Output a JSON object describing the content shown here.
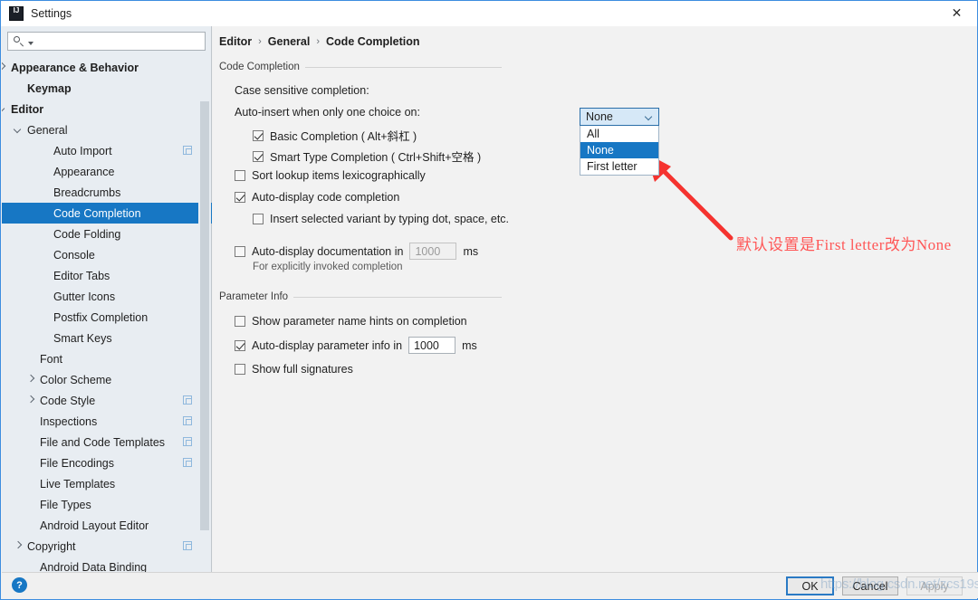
{
  "window": {
    "title": "Settings",
    "logo_icon": "intellij-logo-icon",
    "close_icon": "close-icon"
  },
  "search": {
    "value": "",
    "placeholder": "",
    "icon": "search-icon",
    "caret_icon": "chevron-down-icon"
  },
  "sidebar": {
    "items": [
      {
        "label": "Appearance & Behavior",
        "indent": 10,
        "arrow": "right",
        "bold": true,
        "selected": false,
        "badge": false
      },
      {
        "label": "Keymap",
        "indent": 28,
        "arrow": "none",
        "bold": true,
        "selected": false,
        "badge": false
      },
      {
        "label": "Editor",
        "indent": 10,
        "arrow": "down",
        "bold": true,
        "selected": false,
        "badge": false
      },
      {
        "label": "General",
        "indent": 28,
        "arrow": "down",
        "bold": false,
        "selected": false,
        "badge": false
      },
      {
        "label": "Auto Import",
        "indent": 57,
        "arrow": "none",
        "bold": false,
        "selected": false,
        "badge": true
      },
      {
        "label": "Appearance",
        "indent": 57,
        "arrow": "none",
        "bold": false,
        "selected": false,
        "badge": false
      },
      {
        "label": "Breadcrumbs",
        "indent": 57,
        "arrow": "none",
        "bold": false,
        "selected": false,
        "badge": false
      },
      {
        "label": "Code Completion",
        "indent": 57,
        "arrow": "none",
        "bold": false,
        "selected": true,
        "badge": false
      },
      {
        "label": "Code Folding",
        "indent": 57,
        "arrow": "none",
        "bold": false,
        "selected": false,
        "badge": false
      },
      {
        "label": "Console",
        "indent": 57,
        "arrow": "none",
        "bold": false,
        "selected": false,
        "badge": false
      },
      {
        "label": "Editor Tabs",
        "indent": 57,
        "arrow": "none",
        "bold": false,
        "selected": false,
        "badge": false
      },
      {
        "label": "Gutter Icons",
        "indent": 57,
        "arrow": "none",
        "bold": false,
        "selected": false,
        "badge": false
      },
      {
        "label": "Postfix Completion",
        "indent": 57,
        "arrow": "none",
        "bold": false,
        "selected": false,
        "badge": false
      },
      {
        "label": "Smart Keys",
        "indent": 57,
        "arrow": "none",
        "bold": false,
        "selected": false,
        "badge": false
      },
      {
        "label": "Font",
        "indent": 42,
        "arrow": "none",
        "bold": false,
        "selected": false,
        "badge": false
      },
      {
        "label": "Color Scheme",
        "indent": 42,
        "arrow": "right",
        "bold": false,
        "selected": false,
        "badge": false
      },
      {
        "label": "Code Style",
        "indent": 42,
        "arrow": "right",
        "bold": false,
        "selected": false,
        "badge": true
      },
      {
        "label": "Inspections",
        "indent": 42,
        "arrow": "none",
        "bold": false,
        "selected": false,
        "badge": true
      },
      {
        "label": "File and Code Templates",
        "indent": 42,
        "arrow": "none",
        "bold": false,
        "selected": false,
        "badge": true
      },
      {
        "label": "File Encodings",
        "indent": 42,
        "arrow": "none",
        "bold": false,
        "selected": false,
        "badge": true
      },
      {
        "label": "Live Templates",
        "indent": 42,
        "arrow": "none",
        "bold": false,
        "selected": false,
        "badge": false
      },
      {
        "label": "File Types",
        "indent": 42,
        "arrow": "none",
        "bold": false,
        "selected": false,
        "badge": false
      },
      {
        "label": "Android Layout Editor",
        "indent": 42,
        "arrow": "none",
        "bold": false,
        "selected": false,
        "badge": false
      },
      {
        "label": "Copyright",
        "indent": 28,
        "arrow": "right",
        "bold": false,
        "selected": false,
        "badge": true
      },
      {
        "label": "Android Data Binding",
        "indent": 42,
        "arrow": "none",
        "bold": false,
        "selected": false,
        "badge": false
      }
    ]
  },
  "breadcrumb": {
    "part1": "Editor",
    "sep1": "›",
    "part2": "General",
    "sep2": "›",
    "part3": "Code Completion"
  },
  "main": {
    "section_code_completion": "Code Completion",
    "section_parameter_info": "Parameter Info",
    "case_sensitive_label": "Case sensitive completion:",
    "auto_insert_label": "Auto-insert when only one choice on:",
    "basic_completion_label": "Basic Completion ( Alt+斜杠 )",
    "smart_type_label": "Smart Type Completion ( Ctrl+Shift+空格 )",
    "sort_lookup_label": "Sort lookup items lexicographically",
    "auto_display_code_label": "Auto-display code completion",
    "insert_variant_label": "Insert selected variant by typing dot, space, etc.",
    "auto_display_doc_label": "Auto-display documentation in",
    "auto_display_doc_value": "1000",
    "auto_display_doc_unit": "ms",
    "doc_hint": "For explicitly invoked completion",
    "show_param_hints_label": "Show parameter name hints on completion",
    "auto_display_param_label": "Auto-display parameter info in",
    "auto_display_param_value": "1000",
    "auto_display_param_unit": "ms",
    "show_full_signatures_label": "Show full signatures"
  },
  "combobox": {
    "selected": "None",
    "arrow_icon": "chevron-down-icon",
    "options": [
      "All",
      "None",
      "First letter"
    ],
    "highlighted_index": 1
  },
  "annotation": {
    "text": "默认设置是First letter改为None",
    "color": "#ff5757",
    "arrow_icon": "red-arrow-icon"
  },
  "footer": {
    "help_icon": "help-icon",
    "help_glyph": "?",
    "ok_label": "OK",
    "cancel_label": "Cancel",
    "apply_label": "Apply"
  },
  "watermark": {
    "text": "https://blog.csdn.net/zcs19s"
  },
  "colors": {
    "selection_blue": "#1777c4",
    "window_border": "#3d8de0",
    "sidebar_bg": "#e8edf2",
    "content_bg": "#f2f2f2",
    "annotation_red": "#ff5757"
  }
}
